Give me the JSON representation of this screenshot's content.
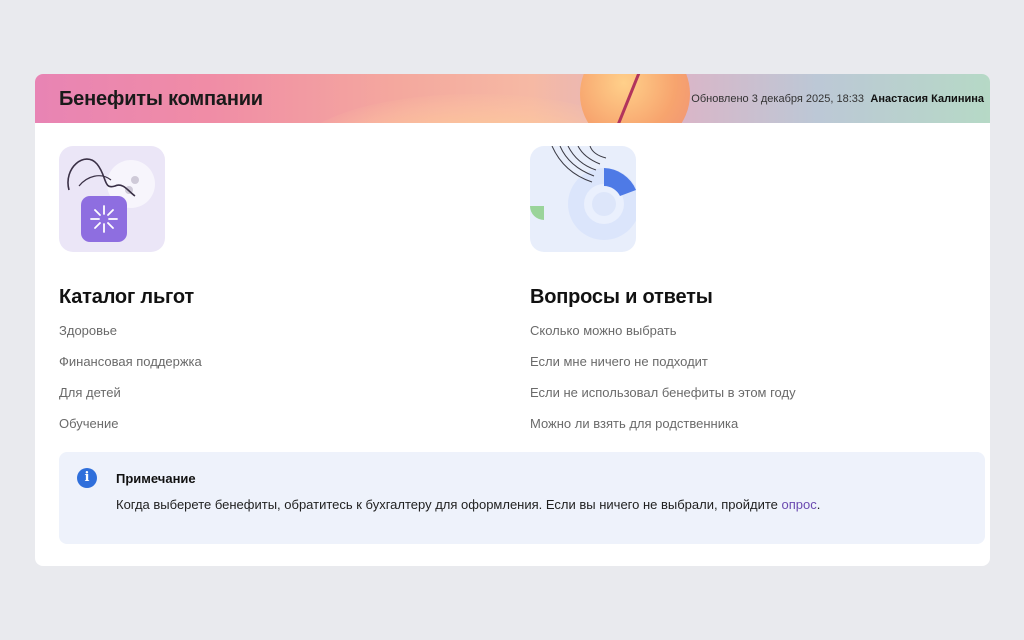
{
  "header": {
    "title": "Бенефиты компании",
    "updated": "Обновлено 3 декабря 2025, 18:33",
    "user": "Анастасия Калинина"
  },
  "catalog": {
    "title": "Каталог льгот",
    "items": [
      {
        "label": "Здоровье"
      },
      {
        "label": "Финансовая поддержка"
      },
      {
        "label": "Для детей"
      },
      {
        "label": "Обучение"
      }
    ]
  },
  "faq": {
    "title": "Вопросы и ответы",
    "items": [
      {
        "label": "Сколько можно выбрать"
      },
      {
        "label": "Если мне ничего не подходит"
      },
      {
        "label": "Если не использовал бенефиты в этом году"
      },
      {
        "label": "Можно ли взять для родственника"
      }
    ]
  },
  "note": {
    "icon": "info-icon",
    "icon_glyph": "i",
    "title": "Примечание",
    "text": "Когда выберете бенефиты, обратитесь к бухгалтеру для оформления. Если вы ничего не выбрали, пройдите ",
    "link": "опрос",
    "text_end": "."
  },
  "colors": {
    "accent_blue": "#2f6fdb",
    "link_purple": "#6b4ab0",
    "tile_purple": "#8e6ee0"
  }
}
